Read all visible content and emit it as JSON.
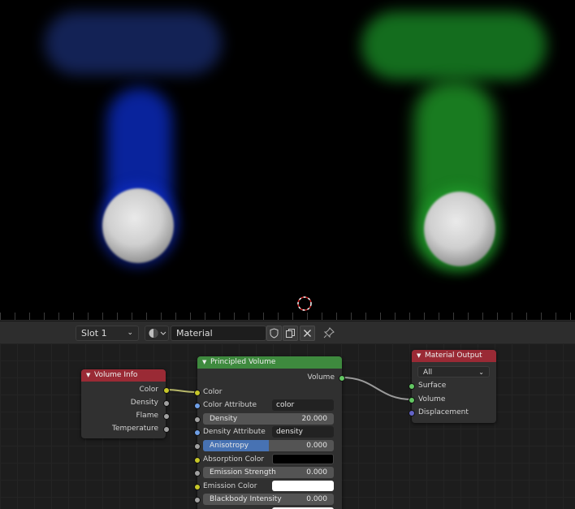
{
  "header": {
    "slot_label": "Slot 1",
    "material_name": "Material",
    "material_type_icon": "sphere-icon",
    "icons": [
      "shield-icon",
      "copy-icon",
      "close-icon",
      "pin-icon"
    ]
  },
  "nodes": {
    "volume_info": {
      "title": "Volume Info",
      "outputs": [
        "Color",
        "Density",
        "Flame",
        "Temperature"
      ]
    },
    "principled_volume": {
      "title": "Principled Volume",
      "output": "Volume",
      "color_label": "Color",
      "color_attribute_label": "Color Attribute",
      "color_attribute_value": "color",
      "density_label": "Density",
      "density_value": "20.000",
      "density_attribute_label": "Density Attribute",
      "density_attribute_value": "density",
      "anisotropy_label": "Anisotropy",
      "anisotropy_value": "0.000",
      "anisotropy_fraction": 0.5,
      "absorption_label": "Absorption Color",
      "absorption_color": "#000000",
      "emission_strength_label": "Emission Strength",
      "emission_strength_value": "0.000",
      "emission_color_label": "Emission Color",
      "emission_color": "#ffffff",
      "blackbody_label": "Blackbody Intensity",
      "blackbody_value": "0.000"
    },
    "material_output": {
      "title": "Material Output",
      "target": "All",
      "inputs": [
        "Surface",
        "Volume",
        "Displacement"
      ]
    }
  },
  "colors": {
    "header_red": "#9a2a35",
    "header_green": "#3e8a3e",
    "socket_yellow": "#c7c729",
    "socket_gray": "#a1a1a1",
    "socket_green": "#63c763",
    "socket_blue": "#6f9fe6",
    "socket_purple": "#6363c7"
  }
}
